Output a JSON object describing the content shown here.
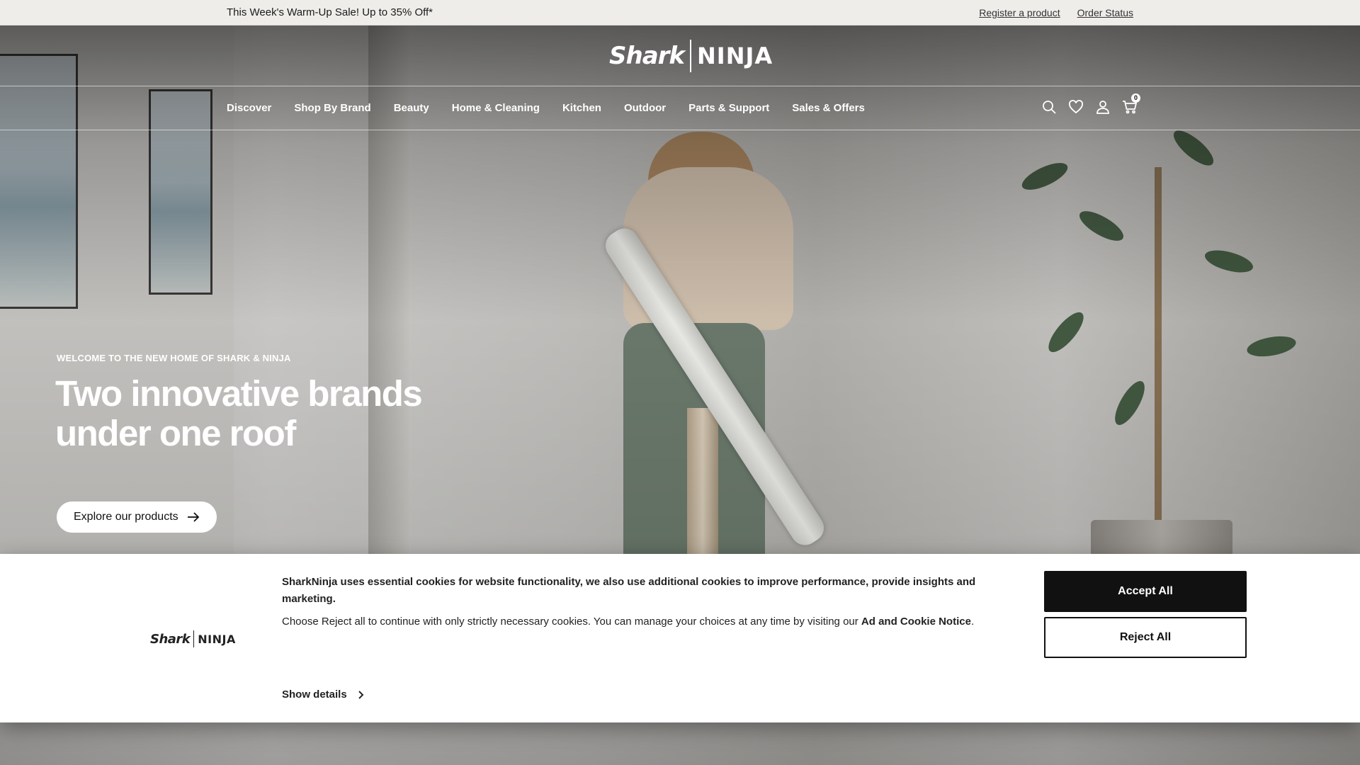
{
  "promo": {
    "text": "This Week's Warm-Up Sale! Up to 35% Off*",
    "links": [
      "Register a product",
      "Order Status"
    ]
  },
  "header": {
    "logo_left": "Shark",
    "logo_right": "NINJA",
    "nav": [
      "Discover",
      "Shop By Brand",
      "Beauty",
      "Home & Cleaning",
      "Kitchen",
      "Outdoor",
      "Parts & Support",
      "Sales & Offers"
    ],
    "icons": [
      "search-icon",
      "wishlist-heart-icon",
      "account-icon",
      "cart-icon"
    ],
    "cart_count": "0"
  },
  "hero": {
    "eyebrow": "WELCOME TO THE NEW HOME OF SHARK & NINJA",
    "heading": "Two innovative brands under one roof",
    "cta": "Explore our products"
  },
  "cookie": {
    "logo_left": "Shark",
    "logo_right": "NINJA",
    "lead": "SharkNinja uses essential cookies for website functionality, we also use additional cookies to improve performance, provide insights and marketing.",
    "body_prefix": "Choose Reject all to continue with only strictly necessary cookies.  You can manage your choices at any time by visiting our ",
    "link_text": "Ad and Cookie Notice",
    "body_suffix": ".",
    "show_details": "Show details",
    "accept_label": "Accept All",
    "reject_label": "Reject All"
  }
}
